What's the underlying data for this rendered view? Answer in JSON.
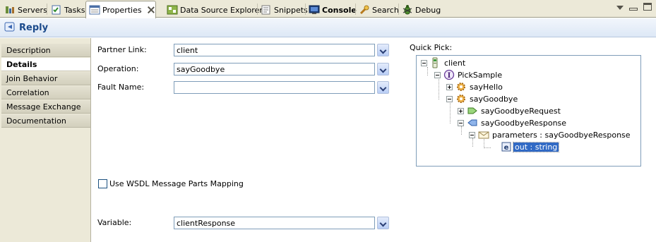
{
  "tabs": [
    {
      "label": "Servers",
      "icon": "servers-icon",
      "active": false
    },
    {
      "label": "Tasks",
      "icon": "tasks-icon",
      "active": false
    },
    {
      "label": "Properties",
      "icon": "properties-icon",
      "active": true
    },
    {
      "label": "Data Source Explorer",
      "icon": "data-source-explorer-icon",
      "active": false
    },
    {
      "label": "Snippets",
      "icon": "snippets-icon",
      "active": false
    },
    {
      "label": "Console",
      "icon": "console-icon",
      "active": false
    },
    {
      "label": "Search",
      "icon": "search-icon",
      "active": false
    },
    {
      "label": "Debug",
      "icon": "debug-icon",
      "active": false
    }
  ],
  "header": {
    "title": "Reply",
    "icon": "reply-icon"
  },
  "sidebar": {
    "items": [
      {
        "label": "Description"
      },
      {
        "label": "Details"
      },
      {
        "label": "Join Behavior"
      },
      {
        "label": "Correlation"
      },
      {
        "label": "Message Exchange"
      },
      {
        "label": "Documentation"
      }
    ]
  },
  "form": {
    "partner_link_label": "Partner Link:",
    "partner_link_value": "client",
    "operation_label": "Operation:",
    "operation_value": "sayGoodbye",
    "fault_name_label": "Fault Name:",
    "fault_name_value": "",
    "wsdl_mapping_label": "Use WSDL Message Parts Mapping",
    "wsdl_mapping_checked": false,
    "variable_label": "Variable:",
    "variable_value": "clientResponse"
  },
  "quick_pick": {
    "label": "Quick Pick:",
    "nodes": [
      {
        "label": "client",
        "icon": "partner-link-icon",
        "toggle": "-"
      },
      {
        "label": "PickSample",
        "icon": "interface-icon",
        "toggle": "-"
      },
      {
        "label": "sayHello",
        "icon": "operation-icon",
        "toggle": "+"
      },
      {
        "label": "sayGoodbye",
        "icon": "operation-icon",
        "toggle": "-"
      },
      {
        "label": "sayGoodbyeRequest",
        "icon": "input-message-icon",
        "toggle": "+"
      },
      {
        "label": "sayGoodbyeResponse",
        "icon": "output-message-icon",
        "toggle": "-"
      },
      {
        "label": "parameters : sayGoodbyeResponse",
        "icon": "message-part-icon",
        "toggle": "-"
      },
      {
        "label": "out : string",
        "icon": "element-icon",
        "toggle": "",
        "selected": true
      }
    ]
  },
  "colors": {
    "header_title": "#1c4b8c",
    "selection": "#316ac5",
    "chrome": "#ece9d8"
  }
}
